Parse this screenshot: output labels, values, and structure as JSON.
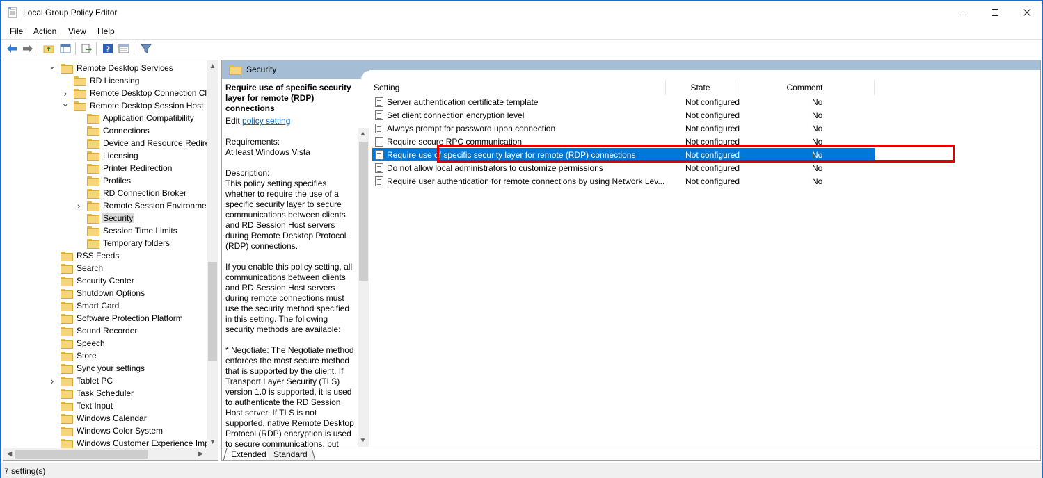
{
  "window": {
    "title": "Local Group Policy Editor"
  },
  "menu": [
    "File",
    "Action",
    "View",
    "Help"
  ],
  "toolbar": {
    "icons": [
      "back-arrow-icon",
      "forward-arrow-icon",
      "up-folder-icon",
      "show-hide-tree-icon",
      "export-list-icon",
      "help-icon",
      "properties-icon",
      "filter-icon"
    ]
  },
  "tree": {
    "items": [
      {
        "label": "Remote Desktop Services",
        "indent": 1,
        "expander": "open"
      },
      {
        "label": "RD Licensing",
        "indent": 2,
        "expander": ""
      },
      {
        "label": "Remote Desktop Connection Cli",
        "indent": 2,
        "expander": "closed"
      },
      {
        "label": "Remote Desktop Session Host",
        "indent": 2,
        "expander": "open"
      },
      {
        "label": "Application Compatibility",
        "indent": 3,
        "expander": ""
      },
      {
        "label": "Connections",
        "indent": 3,
        "expander": ""
      },
      {
        "label": "Device and Resource Redirec",
        "indent": 3,
        "expander": ""
      },
      {
        "label": "Licensing",
        "indent": 3,
        "expander": ""
      },
      {
        "label": "Printer Redirection",
        "indent": 3,
        "expander": ""
      },
      {
        "label": "Profiles",
        "indent": 3,
        "expander": ""
      },
      {
        "label": "RD Connection Broker",
        "indent": 3,
        "expander": ""
      },
      {
        "label": "Remote Session Environment",
        "indent": 3,
        "expander": "closed"
      },
      {
        "label": "Security",
        "indent": 3,
        "expander": "",
        "selected": true
      },
      {
        "label": "Session Time Limits",
        "indent": 3,
        "expander": ""
      },
      {
        "label": "Temporary folders",
        "indent": 3,
        "expander": ""
      },
      {
        "label": "RSS Feeds",
        "indent": 1,
        "expander": ""
      },
      {
        "label": "Search",
        "indent": 1,
        "expander": ""
      },
      {
        "label": "Security Center",
        "indent": 1,
        "expander": ""
      },
      {
        "label": "Shutdown Options",
        "indent": 1,
        "expander": ""
      },
      {
        "label": "Smart Card",
        "indent": 1,
        "expander": ""
      },
      {
        "label": "Software Protection Platform",
        "indent": 1,
        "expander": ""
      },
      {
        "label": "Sound Recorder",
        "indent": 1,
        "expander": ""
      },
      {
        "label": "Speech",
        "indent": 1,
        "expander": ""
      },
      {
        "label": "Store",
        "indent": 1,
        "expander": ""
      },
      {
        "label": "Sync your settings",
        "indent": 1,
        "expander": ""
      },
      {
        "label": "Tablet PC",
        "indent": 1,
        "expander": "closed"
      },
      {
        "label": "Task Scheduler",
        "indent": 1,
        "expander": ""
      },
      {
        "label": "Text Input",
        "indent": 1,
        "expander": ""
      },
      {
        "label": "Windows Calendar",
        "indent": 1,
        "expander": ""
      },
      {
        "label": "Windows Color System",
        "indent": 1,
        "expander": ""
      },
      {
        "label": "Windows Customer Experience Impi",
        "indent": 1,
        "expander": ""
      }
    ]
  },
  "header": {
    "folder_title": "Security"
  },
  "description": {
    "title": "Require use of specific security layer for remote (RDP) connections",
    "edit_prefix": "Edit",
    "edit_link": "policy setting",
    "requirements_label": "Requirements:",
    "requirements_value": "At least Windows Vista",
    "description_label": "Description:",
    "paragraph1": "This policy setting specifies whether to require the use of a specific security layer to secure communications between clients and RD Session Host servers during Remote Desktop Protocol (RDP) connections.",
    "paragraph2": "If you enable this policy setting, all communications between clients and RD Session Host servers during remote connections must use the security method specified in this setting. The following security methods are available:",
    "paragraph3": "* Negotiate: The Negotiate method enforces the most secure method that is supported by the client. If Transport Layer Security (TLS) version 1.0 is supported, it is used to authenticate the RD Session Host server. If TLS is not supported, native Remote Desktop Protocol (RDP) encryption is used to secure communications, but"
  },
  "list": {
    "columns": {
      "setting": "Setting",
      "state": "State",
      "comment": "Comment"
    },
    "rows": [
      {
        "setting": "Server authentication certificate template",
        "state": "Not configured",
        "comment": "No"
      },
      {
        "setting": "Set client connection encryption level",
        "state": "Not configured",
        "comment": "No"
      },
      {
        "setting": "Always prompt for password upon connection",
        "state": "Not configured",
        "comment": "No"
      },
      {
        "setting": "Require secure RPC communication",
        "state": "Not configured",
        "comment": "No"
      },
      {
        "setting": "Require use of specific security layer for remote (RDP) connections",
        "state": "Not configured",
        "comment": "No",
        "selected": true
      },
      {
        "setting": "Do not allow local administrators to customize permissions",
        "state": "Not configured",
        "comment": "No"
      },
      {
        "setting": "Require user authentication for remote connections by using Network Lev...",
        "state": "Not configured",
        "comment": "No"
      }
    ]
  },
  "tabs": {
    "extended": "Extended",
    "standard": "Standard"
  },
  "status": {
    "text": "7 setting(s)"
  },
  "colors": {
    "selection": "#0078d7",
    "header_band": "#a6bdd6",
    "highlight_box": "#e00000",
    "link": "#0066cc"
  }
}
